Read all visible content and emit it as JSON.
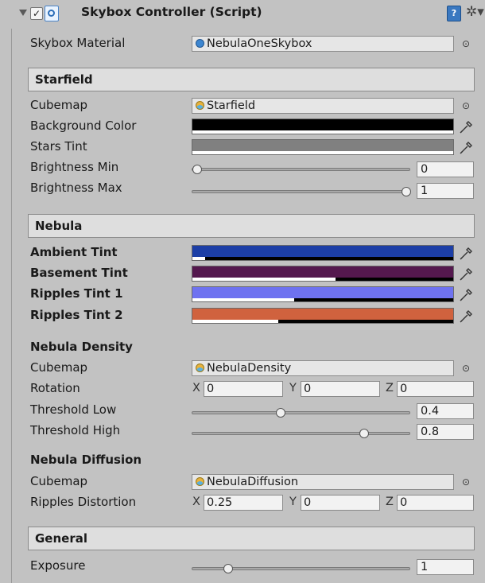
{
  "header": {
    "title": "Skybox Controller (Script)",
    "checkbox_mark": "✓",
    "book_glyph": "?",
    "gear_glyph": "✲▾"
  },
  "skybox_material": {
    "label": "Skybox Material",
    "value": "NebulaOneSkybox",
    "picker": "⊙"
  },
  "starfield": {
    "title": "Starfield",
    "cubemap": {
      "label": "Cubemap",
      "value": "Starfield"
    },
    "background_color": {
      "label": "Background Color",
      "color": "#000000",
      "alpha": 1.0
    },
    "stars_tint": {
      "label": "Stars Tint",
      "color": "#808080",
      "alpha": 1.0
    },
    "brightness_min": {
      "label": "Brightness Min",
      "value": "0",
      "level": 0.0
    },
    "brightness_max": {
      "label": "Brightness Max",
      "value": "1",
      "level": 1.0
    }
  },
  "nebula": {
    "title": "Nebula",
    "ambient_tint": {
      "label": "Ambient Tint",
      "color": "#1c3ea6",
      "alpha": 0.05
    },
    "basement_tint": {
      "label": "Basement Tint",
      "color": "#54184e",
      "alpha": 0.55
    },
    "ripples_tint_1": {
      "label": "Ripples Tint 1",
      "color": "#6e72f0",
      "alpha": 0.39
    },
    "ripples_tint_2": {
      "label": "Ripples Tint 2",
      "color": "#d0623e",
      "alpha": 0.33
    }
  },
  "nebula_density": {
    "title": "Nebula Density",
    "cubemap": {
      "label": "Cubemap",
      "value": "NebulaDensity"
    },
    "rotation": {
      "label": "Rotation",
      "x_label": "X",
      "x": "0",
      "y_label": "Y",
      "y": "0",
      "z_label": "Z",
      "z": "0"
    },
    "threshold_low": {
      "label": "Threshold Low",
      "value": "0.4",
      "level": 0.4
    },
    "threshold_high": {
      "label": "Threshold High",
      "value": "0.8",
      "level": 0.8
    }
  },
  "nebula_diffusion": {
    "title": "Nebula Diffusion",
    "cubemap": {
      "label": "Cubemap",
      "value": "NebulaDiffusion"
    },
    "ripples_distortion": {
      "label": "Ripples Distortion",
      "x_label": "X",
      "x": "0.25",
      "y_label": "Y",
      "y": "0",
      "z_label": "Z",
      "z": "0"
    }
  },
  "general": {
    "title": "General",
    "exposure": {
      "label": "Exposure",
      "value": "1",
      "level": 0.15
    }
  }
}
